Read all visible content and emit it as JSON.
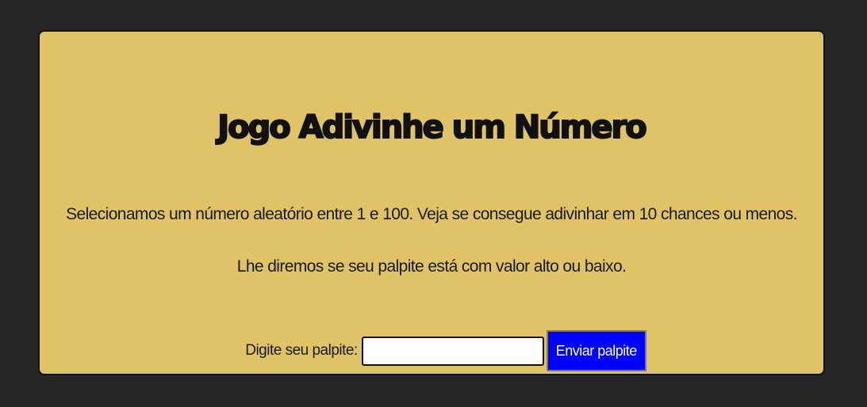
{
  "game": {
    "title": "Jogo Adivinhe um Número",
    "intro": "Selecionamos um número aleatório entre 1 e 100. Veja se consegue adivinhar em 10 chances ou menos.",
    "hint": "Lhe diremos se seu palpite está com valor alto ou baixo."
  },
  "form": {
    "label": "Digite seu palpite:",
    "input_value": "",
    "submit_label": "Enviar palpite"
  },
  "colors": {
    "page_background": "#262626",
    "card_background": "#e0c366",
    "button_background": "#0000ff",
    "button_text": "#ffffff"
  }
}
